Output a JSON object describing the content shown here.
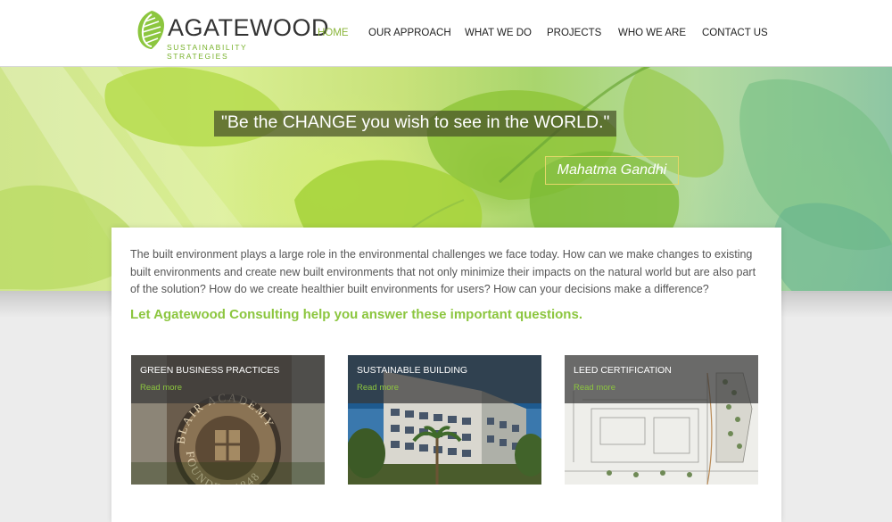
{
  "brand": {
    "name": "AGATEWOOD",
    "tagline": "SUSTAINABILITY STRATEGIES",
    "logo_icon": "leaf-logo-icon",
    "accent_color": "#8cc63f"
  },
  "nav": {
    "items": [
      {
        "label": "HOME",
        "active": true
      },
      {
        "label": "OUR APPROACH",
        "active": false
      },
      {
        "label": "WHAT WE DO",
        "active": false
      },
      {
        "label": "PROJECTS",
        "active": false
      },
      {
        "label": "WHO WE ARE",
        "active": false
      },
      {
        "label": "CONTACT US",
        "active": false
      }
    ]
  },
  "hero": {
    "quote": "\"Be the CHANGE you wish to see in the WORLD.\"",
    "author": "Mahatma Gandhi"
  },
  "intro": {
    "text": "The built environment plays a large role in the environmental challenges we face today. How can we make changes to existing built environments and create new built environments that not only minimize their impacts on the natural world but are also part of the solution? How do we create healthier built environments for users? How can your decisions make a difference?",
    "cta": "Let Agatewood Consulting help you answer these important questions."
  },
  "tiles": [
    {
      "title": "GREEN BUSINESS PRACTICES",
      "link": "Read more"
    },
    {
      "title": "SUSTAINABLE BUILDING",
      "link": "Read more"
    },
    {
      "title": "LEED CERTIFICATION",
      "link": "Read more"
    }
  ],
  "tile_images": {
    "seal_text_top": "BLAIR ACADEMY",
    "seal_text_bottom": "FOUNDED 1848"
  }
}
